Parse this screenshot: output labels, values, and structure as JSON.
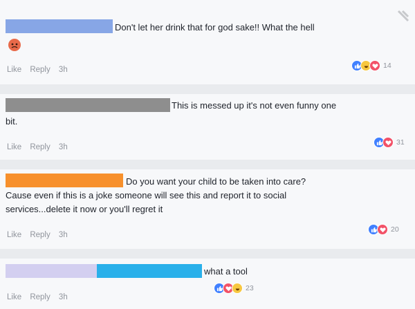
{
  "comments": [
    {
      "text": "Don't let her drink that for god sake!! What the hell",
      "actions": {
        "like": "Like",
        "reply": "Reply",
        "time": "3h"
      },
      "reactions": [
        "like-icon",
        "haha-icon",
        "love-icon"
      ],
      "count": "14",
      "name_color": "#87a6e6"
    },
    {
      "text_line1": "This is messed up it's not even funny one",
      "text_line2": "bit.",
      "actions": {
        "like": "Like",
        "reply": "Reply",
        "time": "3h"
      },
      "reactions": [
        "like-icon",
        "love-icon"
      ],
      "count": "31",
      "name_color": "#8e8e8e"
    },
    {
      "text_line1": "Do you want your child to be taken into care?",
      "text_line2": "Cause even if this is a joke someone will see this and report it to social",
      "text_line3": "services...delete it now or you'll regret it",
      "actions": {
        "like": "Like",
        "reply": "Reply",
        "time": "3h"
      },
      "reactions": [
        "like-icon",
        "love-icon"
      ],
      "count": "20",
      "name_color": "#f7902c"
    },
    {
      "text": "what a tool",
      "actions": {
        "like": "Like",
        "reply": "Reply",
        "time": "3h"
      },
      "reactions": [
        "like-icon",
        "love-icon",
        "haha-icon"
      ],
      "count": "23",
      "name_color_1": "#d3cff0",
      "name_color_2": "#29b0ea"
    }
  ]
}
